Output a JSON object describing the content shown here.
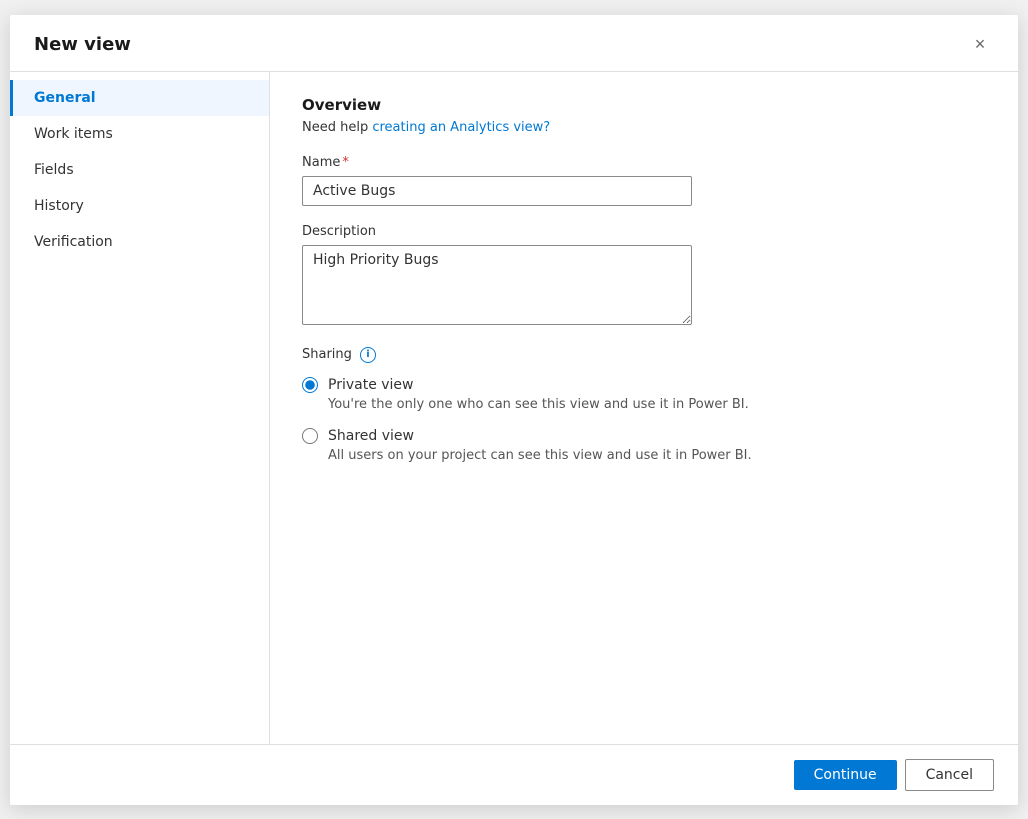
{
  "dialog": {
    "title": "New view",
    "close_label": "×"
  },
  "sidebar": {
    "items": [
      {
        "id": "general",
        "label": "General",
        "active": true
      },
      {
        "id": "work-items",
        "label": "Work items",
        "active": false
      },
      {
        "id": "fields",
        "label": "Fields",
        "active": false
      },
      {
        "id": "history",
        "label": "History",
        "active": false
      },
      {
        "id": "verification",
        "label": "Verification",
        "active": false
      }
    ]
  },
  "main": {
    "section_title": "Overview",
    "help_text_prefix": "Need help ",
    "help_link_label": "creating an Analytics view?",
    "help_link_href": "#",
    "name_label": "Name",
    "name_required": true,
    "name_value": "Active Bugs",
    "name_placeholder": "",
    "description_label": "Description",
    "description_value": "High Priority Bugs",
    "description_placeholder": "",
    "sharing_label": "Sharing",
    "sharing_info_icon": "i",
    "private_view_label": "Private view",
    "private_view_desc": "You're the only one who can see this view and use it in Power BI.",
    "shared_view_label": "Shared view",
    "shared_view_desc": "All users on your project can see this view and use it in Power BI."
  },
  "footer": {
    "continue_label": "Continue",
    "cancel_label": "Cancel"
  }
}
